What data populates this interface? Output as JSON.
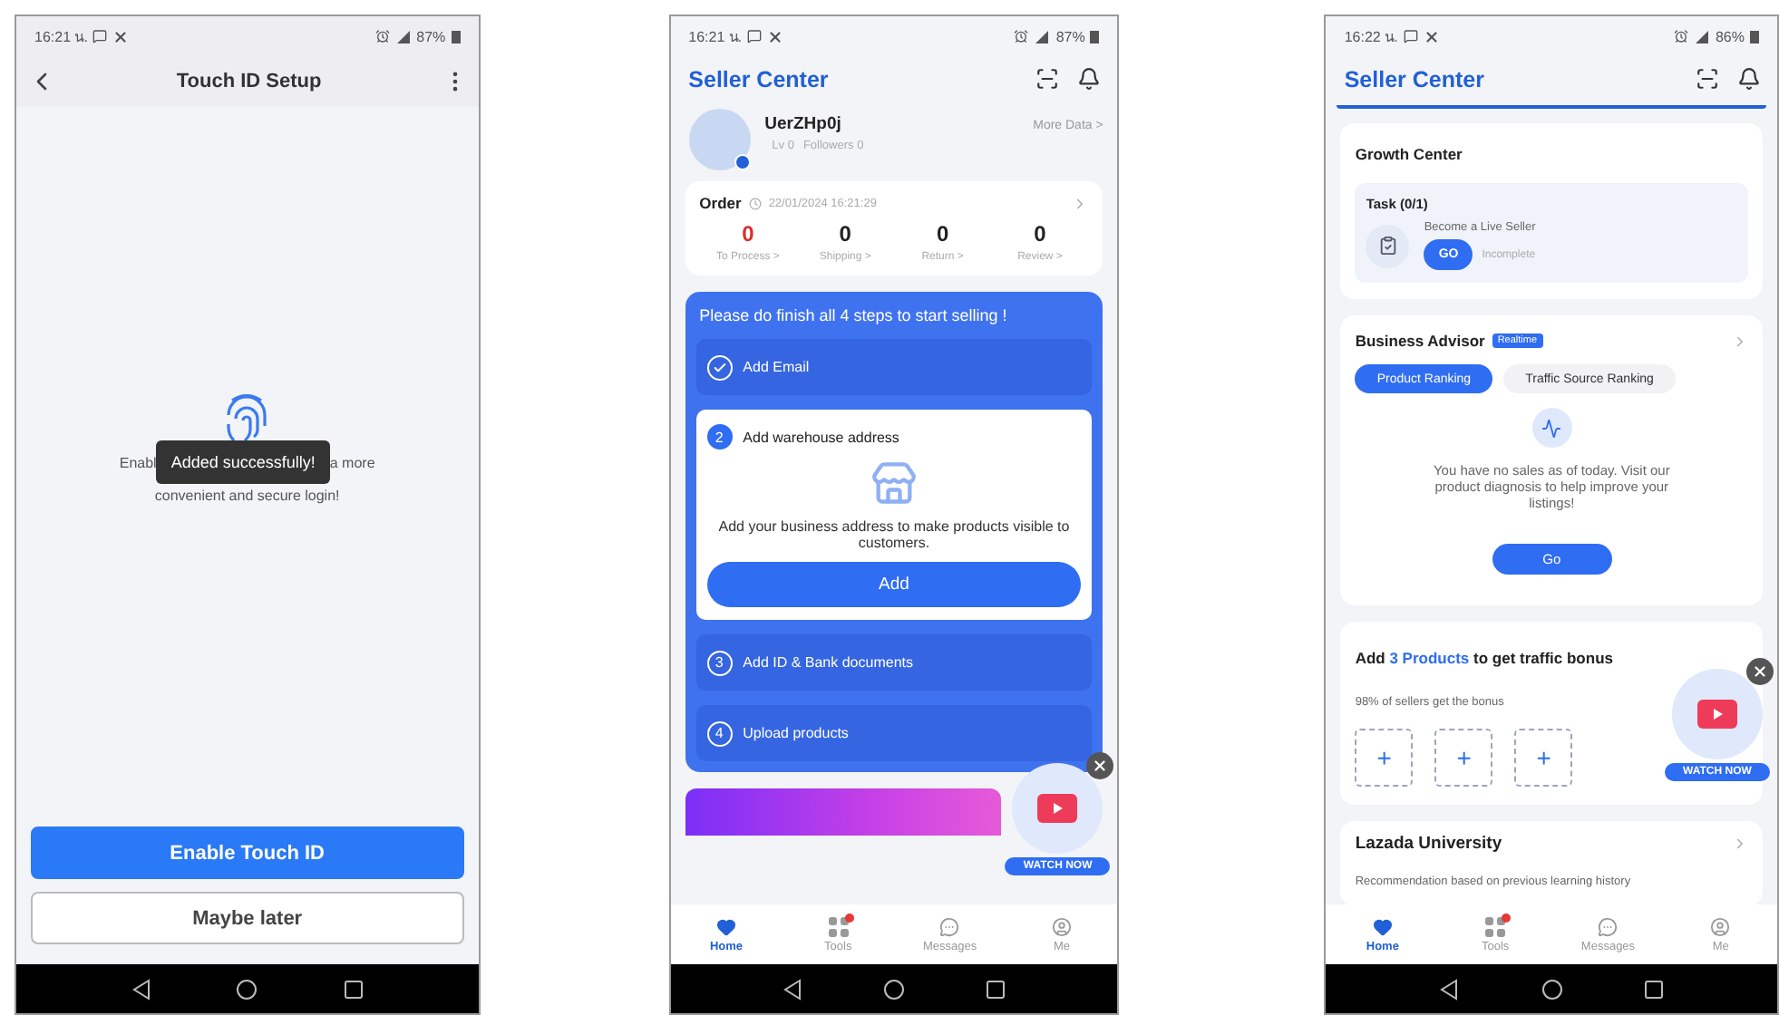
{
  "touch_id_screen": {
    "status_bar": {
      "time": "16:21 น.",
      "battery": "87%"
    },
    "header": {
      "title": "Touch ID Setup"
    },
    "message": {
      "line1_start": "Enabl",
      "line1_end": "a more",
      "line2": "convenient and secure login!"
    },
    "toast": "Added successfully!",
    "buttons": [
      {
        "label": "Enable Touch ID",
        "kind": "primary"
      },
      {
        "label": "Maybe later",
        "kind": "secondary"
      }
    ]
  },
  "seller_home_screen": {
    "status_bar": {
      "time": "16:21 น.",
      "battery": "87%"
    },
    "header": {
      "title": "Seller Center"
    },
    "profile": {
      "name": "UerZHp0j",
      "level": "Lv 0",
      "followers": "Followers 0",
      "more": "More Data >"
    },
    "order": {
      "title": "Order",
      "timestamp": "22/01/2024 16:21:29",
      "stats": [
        {
          "value": "0",
          "label": "To Process >",
          "alert": true
        },
        {
          "value": "0",
          "label": "Shipping >",
          "alert": false
        },
        {
          "value": "0",
          "label": "Return >",
          "alert": false
        },
        {
          "value": "0",
          "label": "Review >",
          "alert": false
        }
      ]
    },
    "steps": {
      "title": "Please do finish all 4 steps to start selling !",
      "items": [
        {
          "label": "Add Email",
          "done": true,
          "expanded": false
        },
        {
          "number": "2",
          "label": "Add warehouse address",
          "done": false,
          "expanded": true,
          "description": "Add your business address to make products visible to customers.",
          "action": "Add"
        },
        {
          "number": "3",
          "label": "Add ID & Bank documents",
          "done": false,
          "expanded": false
        },
        {
          "number": "4",
          "label": "Upload products",
          "done": false,
          "expanded": false
        }
      ]
    },
    "watch_now": {
      "label": "WATCH NOW"
    },
    "tab_bar": [
      {
        "label": "Home",
        "selected": true,
        "badge": false
      },
      {
        "label": "Tools",
        "selected": false,
        "badge": true
      },
      {
        "label": "Messages",
        "selected": false,
        "badge": false
      },
      {
        "label": "Me",
        "selected": false,
        "badge": false
      }
    ]
  },
  "seller_growth_screen": {
    "status_bar": {
      "time": "16:22 น.",
      "battery": "86%"
    },
    "header": {
      "title": "Seller Center"
    },
    "growth_center": {
      "title": "Growth Center",
      "task": {
        "title": "Task (0/1)",
        "name": "Become a Live Seller",
        "action": "GO",
        "status": "Incomplete"
      }
    },
    "business_advisor": {
      "title": "Business Advisor",
      "badge": "Realtime",
      "tabs": [
        {
          "label": "Product Ranking",
          "selected": true
        },
        {
          "label": "Traffic Source Ranking",
          "selected": false
        }
      ],
      "message": "You have no sales as of today. Visit our product diagnosis to help improve your listings!",
      "action": "Go"
    },
    "traffic_bonus": {
      "title_parts": [
        {
          "text": "Add ",
          "highlight": false
        },
        {
          "text": "3 Products",
          "highlight": true
        },
        {
          "text": " to get traffic bonus",
          "highlight": false
        }
      ],
      "subtitle": "98% of sellers get the bonus",
      "slots": [
        "+",
        "+",
        "+"
      ]
    },
    "university": {
      "title": "Lazada University",
      "subtitle": "Recommendation based on previous learning history"
    },
    "watch_now": {
      "label": "WATCH NOW"
    },
    "tab_bar": [
      {
        "label": "Home",
        "selected": true,
        "badge": false
      },
      {
        "label": "Tools",
        "selected": false,
        "badge": true
      },
      {
        "label": "Messages",
        "selected": false,
        "badge": false
      },
      {
        "label": "Me",
        "selected": false,
        "badge": false
      }
    ]
  }
}
